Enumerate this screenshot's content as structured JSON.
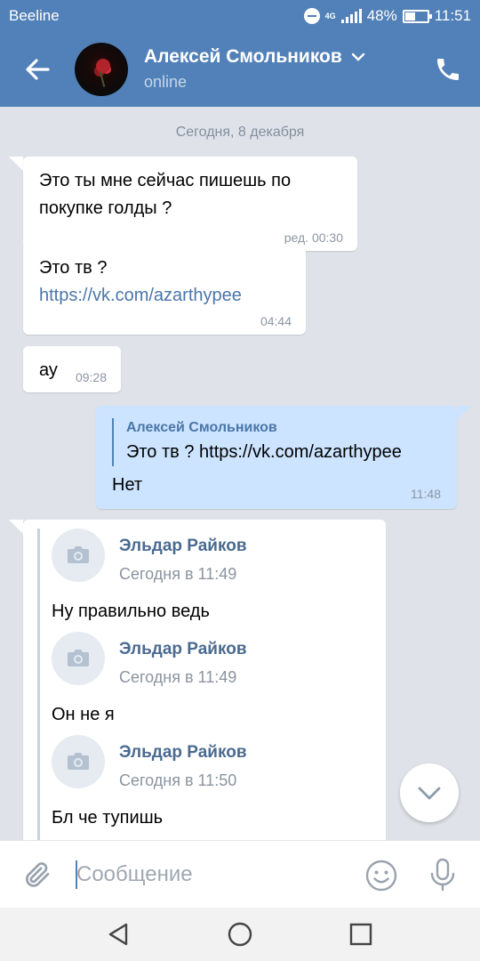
{
  "status_bar": {
    "carrier": "Beeline",
    "network": "4G",
    "battery": "48%",
    "battery_level": 0.48,
    "time": "11:51"
  },
  "header": {
    "contact_name": "Алексей Смольников",
    "status": "online"
  },
  "chat": {
    "date_separator": "Сегодня, 8 декабря",
    "messages": [
      {
        "direction": "in",
        "lines": [
          "Это ты мне сейчас пишешь по",
          "покупке голды ?"
        ],
        "time": "ред. 00:30"
      },
      {
        "direction": "in",
        "text": "Это тв ?",
        "link": "https://vk.com/azarthypee",
        "time": "04:44"
      },
      {
        "direction": "in",
        "text": "ау",
        "time": "09:28"
      },
      {
        "direction": "out",
        "quote_author": "Алексей Смольников",
        "quote_text": "Это тв ? https://vk.com/azarthypee",
        "text": "Нет",
        "time": "11:48"
      }
    ],
    "forwarded": [
      {
        "author": "Эльдар Райков",
        "date": "Сегодня в 11:49",
        "text": "Ну правильно ведь"
      },
      {
        "author": "Эльдар Райков",
        "date": "Сегодня в 11:49",
        "text": "Он не я"
      },
      {
        "author": "Эльдар Райков",
        "date": "Сегодня в 11:50",
        "text": "Бл че тупишь"
      }
    ]
  },
  "input": {
    "placeholder": "Сообщение",
    "value": ""
  },
  "icons": {
    "back": "arrow-left-icon",
    "call": "phone-icon",
    "attach": "paperclip-icon",
    "emoji": "smile-icon",
    "mic": "microphone-icon",
    "scroll": "chevron-down-icon"
  },
  "colors": {
    "accent": "#5181b8",
    "background": "#dfe3e9",
    "outgoing_bubble": "#cce4ff",
    "link": "#4a76a8"
  }
}
